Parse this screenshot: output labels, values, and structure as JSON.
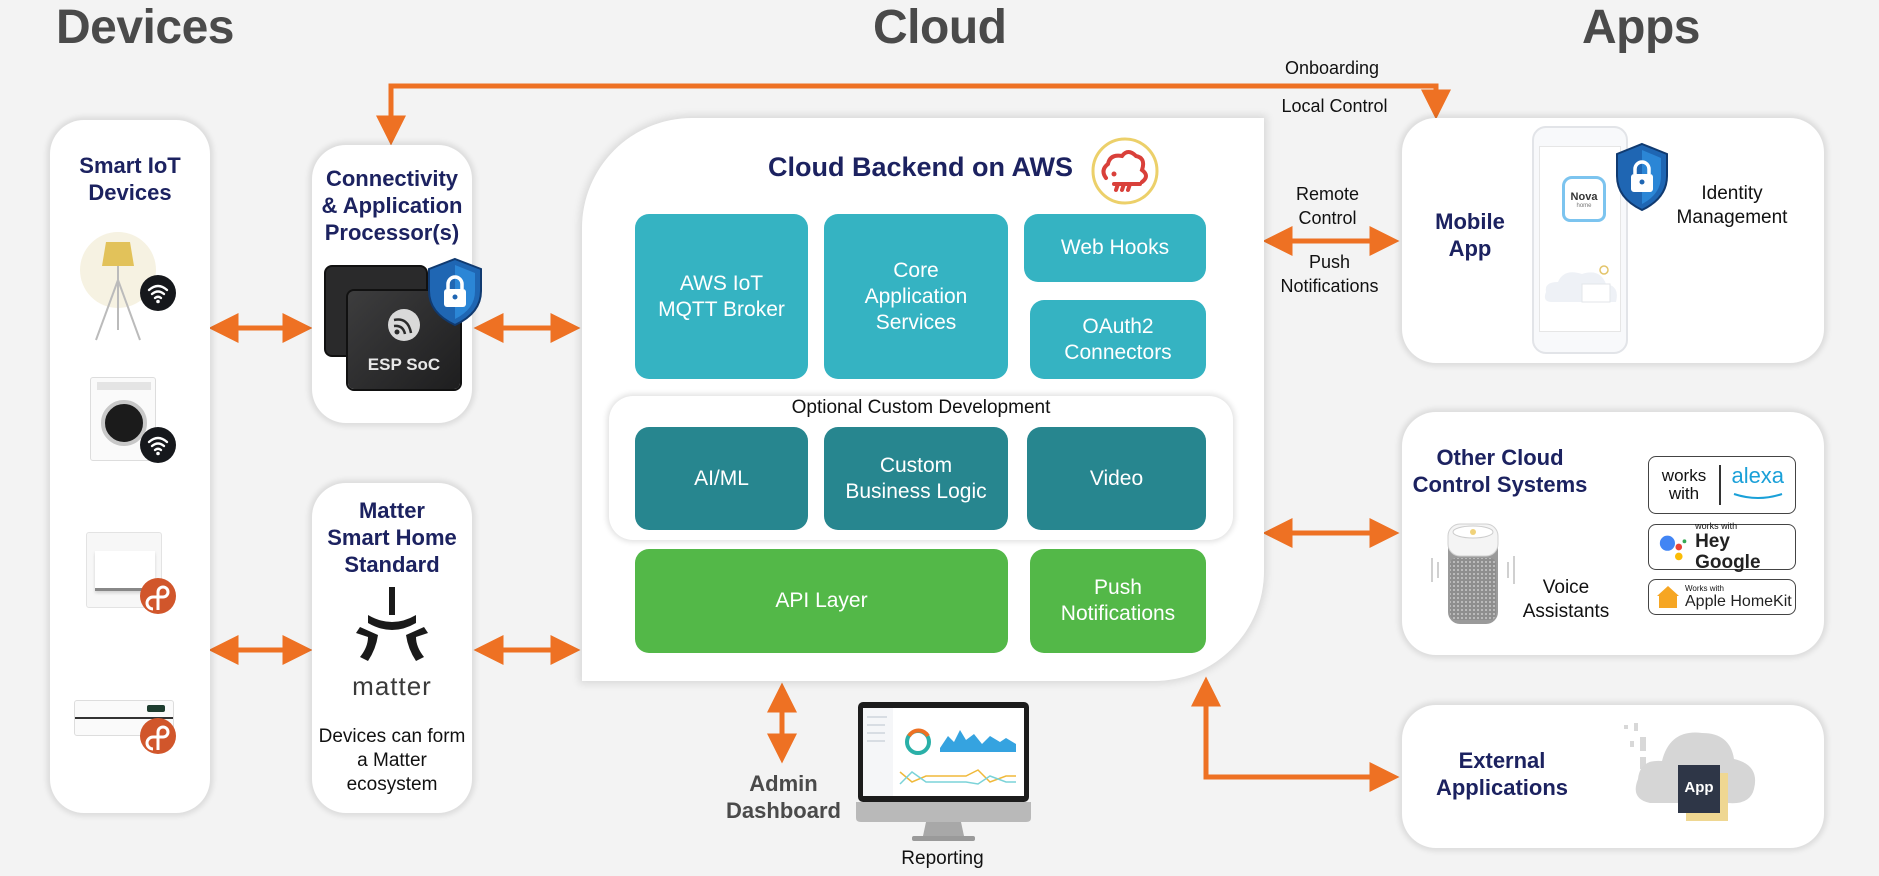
{
  "headings": {
    "devices": "Devices",
    "cloud": "Cloud",
    "apps": "Apps"
  },
  "devices_card": {
    "title": "Smart IoT\nDevices",
    "items": [
      {
        "name": "floor-lamp",
        "protocol": "wifi"
      },
      {
        "name": "washing-machine",
        "protocol": "wifi"
      },
      {
        "name": "wall-switch",
        "protocol": "thread"
      },
      {
        "name": "air-conditioner",
        "protocol": "thread"
      }
    ]
  },
  "connectivity_card": {
    "title": "Connectivity\n& Application\nProcessor(s)",
    "chip_label": "ESP SoC"
  },
  "matter_card": {
    "title": "Matter\nSmart Home\nStandard",
    "logo_text": "matter",
    "description": "Devices can form\na Matter\necosystem"
  },
  "cloud_backend": {
    "title": "Cloud Backend on AWS",
    "tiles_top": [
      {
        "label": "AWS IoT\nMQTT Broker"
      },
      {
        "label": "Core\nApplication\nServices"
      },
      {
        "label": "Web Hooks"
      },
      {
        "label": "OAuth2\nConnectors"
      }
    ],
    "optional_section": {
      "title": "Optional Custom Development",
      "tiles": [
        {
          "label": "AI/ML"
        },
        {
          "label": "Custom\nBusiness Logic"
        },
        {
          "label": "Video"
        }
      ]
    },
    "tiles_bottom": [
      {
        "label": "API Layer"
      },
      {
        "label": "Push\nNotifications"
      }
    ]
  },
  "admin": {
    "label": "Admin\nDashboard",
    "reporting_label": "Reporting"
  },
  "connections": {
    "onboarding": "Onboarding",
    "local_control": "Local Control",
    "remote_control": "Remote\nControl",
    "push_notifications": "Push\nNotifications"
  },
  "mobile_app_card": {
    "title": "Mobile\nApp",
    "identity": "Identity\nManagement",
    "app_logo": "Nova",
    "app_logo_sub": "home"
  },
  "other_cloud_card": {
    "title": "Other Cloud\nControl Systems",
    "voice_label": "Voice\nAssistants",
    "badges": [
      {
        "top": "works\nwith",
        "brand": "alexa"
      },
      {
        "top": "works with",
        "brand": "Hey Google"
      },
      {
        "top": "Works with",
        "brand": "Apple HomeKit"
      }
    ]
  },
  "external_card": {
    "title": "External\nApplications",
    "app_tag": "App"
  },
  "colors": {
    "arrow": "#ee7123",
    "navy": "#1c2260",
    "teal": "#35b3c2",
    "dark_teal": "#27868f",
    "green": "#53b848",
    "heading_gray": "#4a4a4a"
  }
}
